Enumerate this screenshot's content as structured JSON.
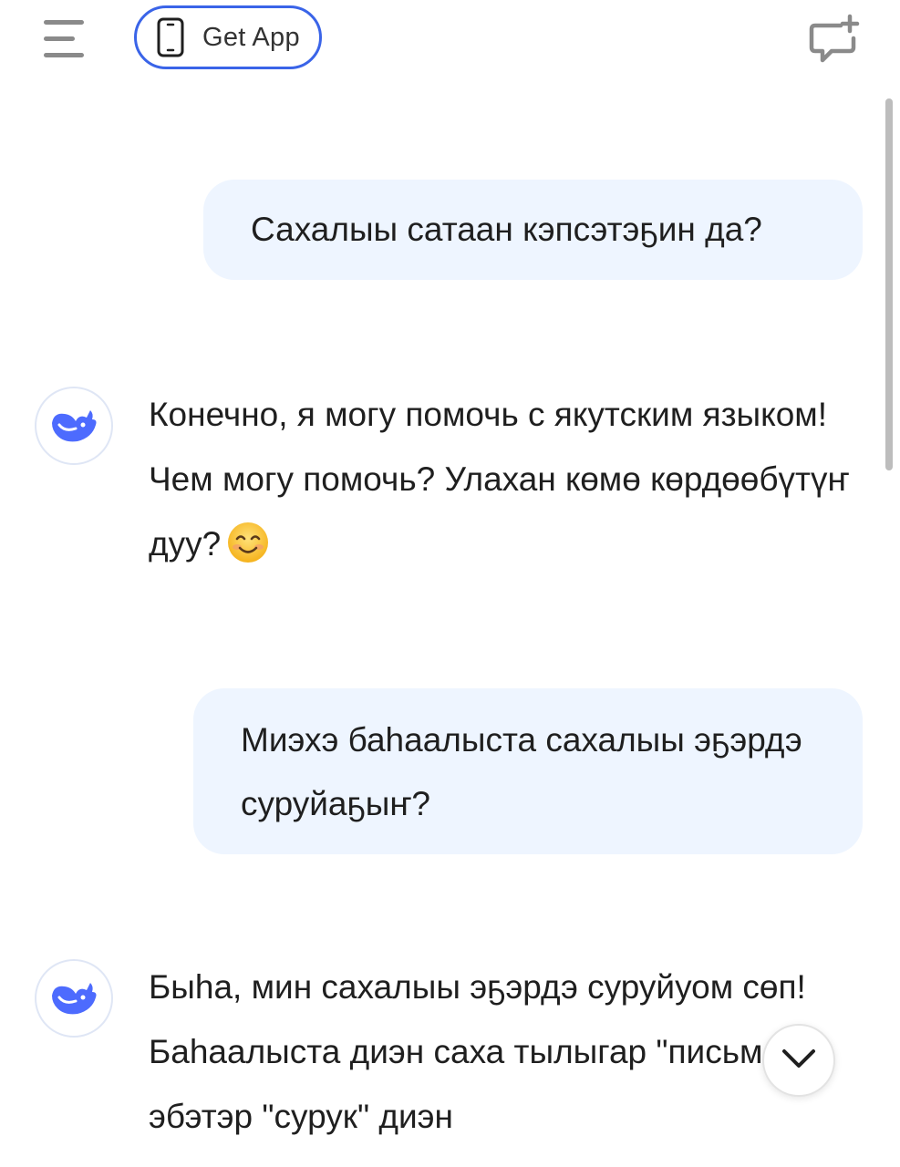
{
  "header": {
    "menu_icon": "hamburger-menu-icon",
    "get_app_label": "Get App",
    "get_app_icon": "smartphone-icon",
    "new_chat_icon": "new-chat-plus-icon",
    "accent_color": "#3a64e8"
  },
  "messages": [
    {
      "role": "user",
      "text": "Сахалыы сатаан кэпсэтэҕин да?"
    },
    {
      "role": "assistant",
      "avatar_icon": "deepseek-whale-logo",
      "text": "Конечно, я могу помочь с якутским языком! Чем могу помочь? Улахан көмө көрдөөбүтүҥ дуу?",
      "emoji": "smiling-face-emoji"
    },
    {
      "role": "user",
      "text": "Миэхэ баһаалыста сахалыы эҕэрдэ суруйаҕыҥ?"
    },
    {
      "role": "assistant",
      "avatar_icon": "deepseek-whale-logo",
      "text": "Быһа, мин сахалыы эҕэрдэ суруйуом сөп! Баһаалыста диэн саха тылыгар \"письмо\" эбэтэр \"сурук\" диэн"
    }
  ],
  "scroll_down_icon": "chevron-down-icon",
  "colors": {
    "user_bubble": "#eef5ff",
    "avatar_border": "#dfe6f5"
  }
}
